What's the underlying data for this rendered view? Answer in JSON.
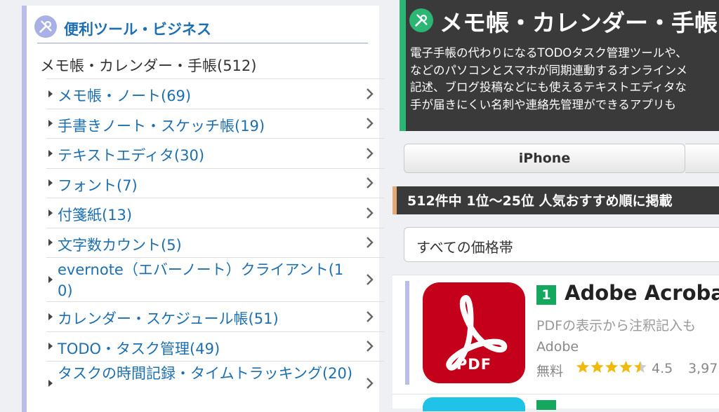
{
  "sidebar": {
    "title": "便利ツール・ビジネス",
    "icon": "tools-icon",
    "current": "メモ帳・カレンダー・手帳(512)",
    "items": [
      {
        "label": "メモ帳・ノート(69)"
      },
      {
        "label": "手書きノート・スケッチ帳(19)"
      },
      {
        "label": "テキストエディタ(30)"
      },
      {
        "label": "フォント(7)"
      },
      {
        "label": "付箋紙(13)"
      },
      {
        "label": "文字数カウント(5)"
      },
      {
        "label": "evernote（エバーノート）クライアント(10)"
      },
      {
        "label": "カレンダー・スケジュール帳(51)"
      },
      {
        "label": "TODO・タスク管理(49)"
      },
      {
        "label": "タスクの時間記録・タイムトラッキング(20)"
      }
    ]
  },
  "banner": {
    "title": "メモ帳・カレンダー・手帳",
    "icon": "tools-icon",
    "description": [
      "電子手帳の代わりになるTODOタスク管理ツールや、",
      "などのパソコンとスマホが同期連動するオンラインメ",
      "記述、ブログ投稿などにも使えるテキストエディタな",
      "手が届きにくい名刺や連絡先管理ができるアプリも"
    ]
  },
  "tabs": [
    {
      "label": "iPhone"
    },
    {
      "label": ""
    }
  ],
  "ranking": {
    "header": "512件中 1位〜25位 人気おすすめ順に掲載"
  },
  "price_filter": {
    "selected": "すべての価格帯"
  },
  "apps": [
    {
      "rank": "1",
      "name": "Adobe Acrobat",
      "description": "PDFの表示から注釈記入も",
      "developer": "Adobe",
      "price": "無料",
      "rating": 4.5,
      "rating_text": "4.5",
      "review_count": "3,97",
      "icon_label": "PDF",
      "icon_color": "#c4001a"
    }
  ],
  "colors": {
    "accent_green": "#2bb673",
    "link_blue": "#1d6fb0",
    "sidebar_accent": "#b9bde8",
    "star_gold": "#f0b90b"
  }
}
